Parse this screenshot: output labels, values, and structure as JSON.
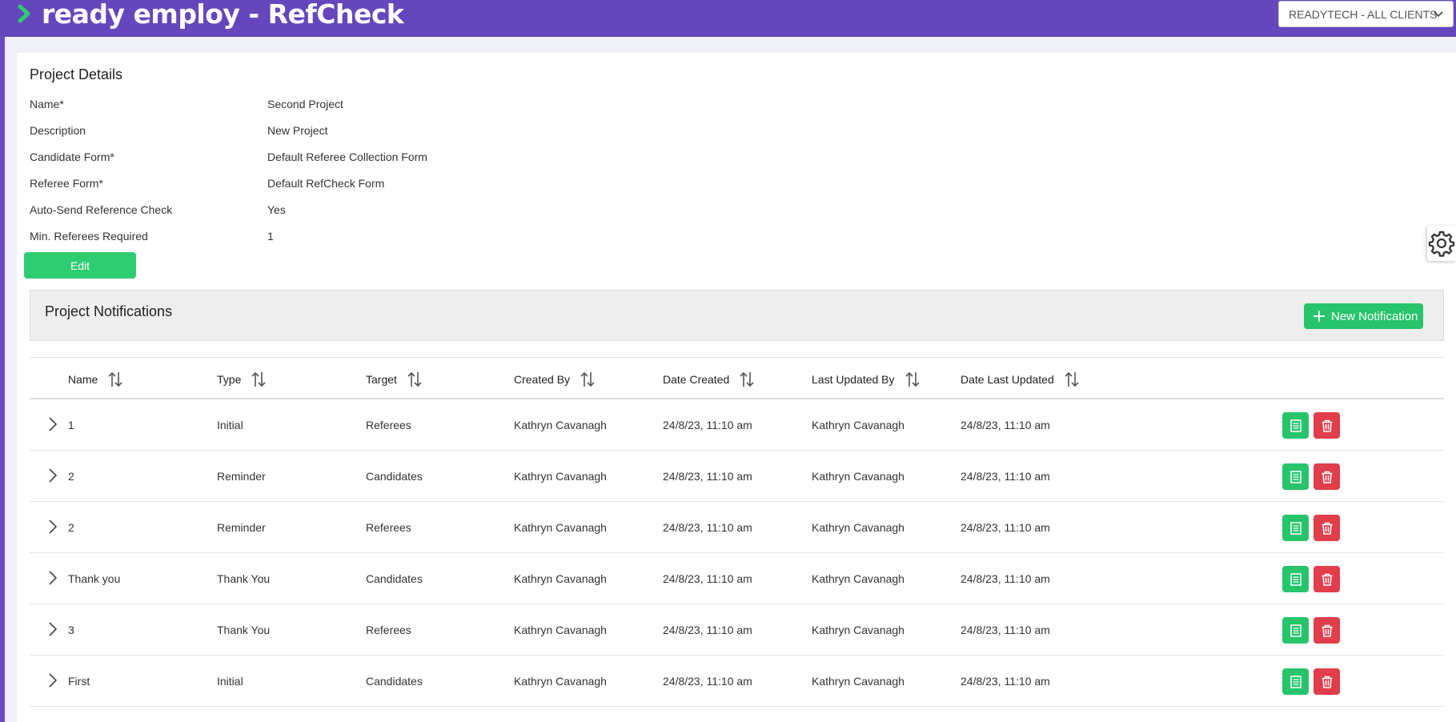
{
  "app": {
    "title": "ready employ - RefCheck",
    "client_select": "READYTECH - ALL CLIENTS"
  },
  "project_details": {
    "title": "Project Details",
    "fields": [
      {
        "label": "Name*",
        "value": "Second Project"
      },
      {
        "label": "Description",
        "value": "New Project"
      },
      {
        "label": "Candidate Form*",
        "value": "Default Referee Collection Form"
      },
      {
        "label": "Referee Form*",
        "value": "Default RefCheck Form"
      },
      {
        "label": "Auto-Send Reference Check",
        "value": "Yes"
      },
      {
        "label": "Min. Referees Required",
        "value": "1"
      }
    ],
    "edit_label": "Edit"
  },
  "notifications": {
    "title": "Project Notifications",
    "new_label": "New Notification",
    "columns": [
      "Name",
      "Type",
      "Target",
      "Created By",
      "Date Created",
      "Last Updated By",
      "Date Last Updated"
    ],
    "rows": [
      {
        "name": "1",
        "type": "Initial",
        "target": "Referees",
        "created_by": "Kathryn Cavanagh",
        "date_created": "24/8/23, 11:10 am",
        "updated_by": "Kathryn Cavanagh",
        "date_updated": "24/8/23, 11:10 am"
      },
      {
        "name": "2",
        "type": "Reminder",
        "target": "Candidates",
        "created_by": "Kathryn Cavanagh",
        "date_created": "24/8/23, 11:10 am",
        "updated_by": "Kathryn Cavanagh",
        "date_updated": "24/8/23, 11:10 am"
      },
      {
        "name": "2",
        "type": "Reminder",
        "target": "Referees",
        "created_by": "Kathryn Cavanagh",
        "date_created": "24/8/23, 11:10 am",
        "updated_by": "Kathryn Cavanagh",
        "date_updated": "24/8/23, 11:10 am"
      },
      {
        "name": "Thank you",
        "type": "Thank You",
        "target": "Candidates",
        "created_by": "Kathryn Cavanagh",
        "date_created": "24/8/23, 11:10 am",
        "updated_by": "Kathryn Cavanagh",
        "date_updated": "24/8/23, 11:10 am"
      },
      {
        "name": "3",
        "type": "Thank You",
        "target": "Referees",
        "created_by": "Kathryn Cavanagh",
        "date_created": "24/8/23, 11:10 am",
        "updated_by": "Kathryn Cavanagh",
        "date_updated": "24/8/23, 11:10 am"
      },
      {
        "name": "First",
        "type": "Initial",
        "target": "Candidates",
        "created_by": "Kathryn Cavanagh",
        "date_created": "24/8/23, 11:10 am",
        "updated_by": "Kathryn Cavanagh",
        "date_updated": "24/8/23, 11:10 am"
      }
    ]
  },
  "colors": {
    "brand": "#6646bd",
    "success": "#27c46b",
    "danger": "#e03e4a"
  },
  "icons": {
    "logo": "chevron-mark-icon",
    "sort": "sort-arrows-icon",
    "expand": "chevron-right-icon",
    "edit": "document-icon",
    "delete": "trash-icon",
    "settings": "gear-icon",
    "add": "plus-icon"
  }
}
